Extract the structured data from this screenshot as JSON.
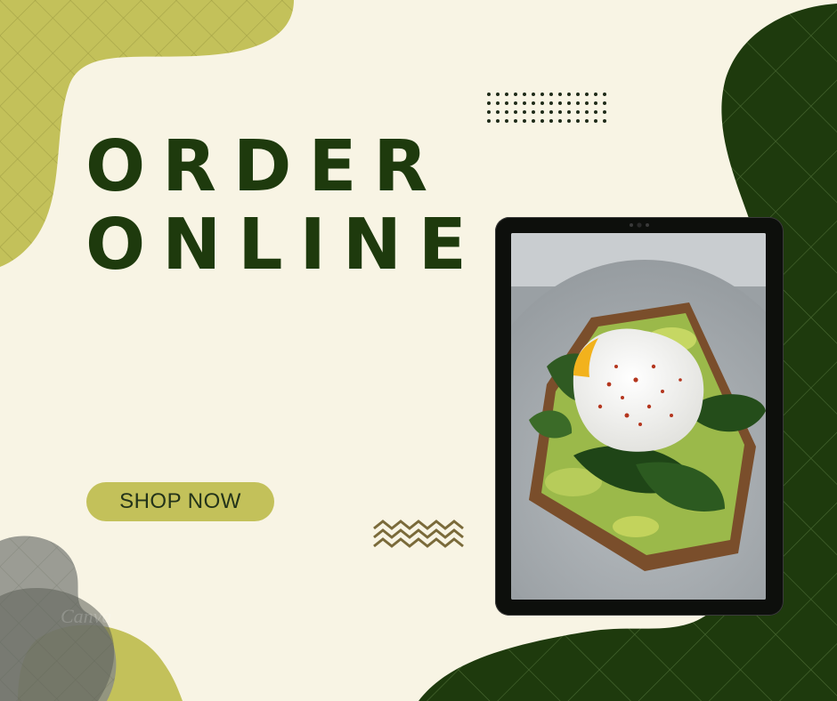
{
  "headline": {
    "line1": "ORDER",
    "line2": "ONLINE"
  },
  "cta": {
    "label": "SHOP NOW"
  },
  "watermark": "Canva",
  "colors": {
    "background": "#f8f4e4",
    "olive": "#c3c15a",
    "dark_green": "#1e3a0d",
    "grey_blob": "#8a8d86",
    "zigzag": "#7a6a3a"
  },
  "icons": [
    "dot-grid-icon",
    "zigzag-icon"
  ]
}
